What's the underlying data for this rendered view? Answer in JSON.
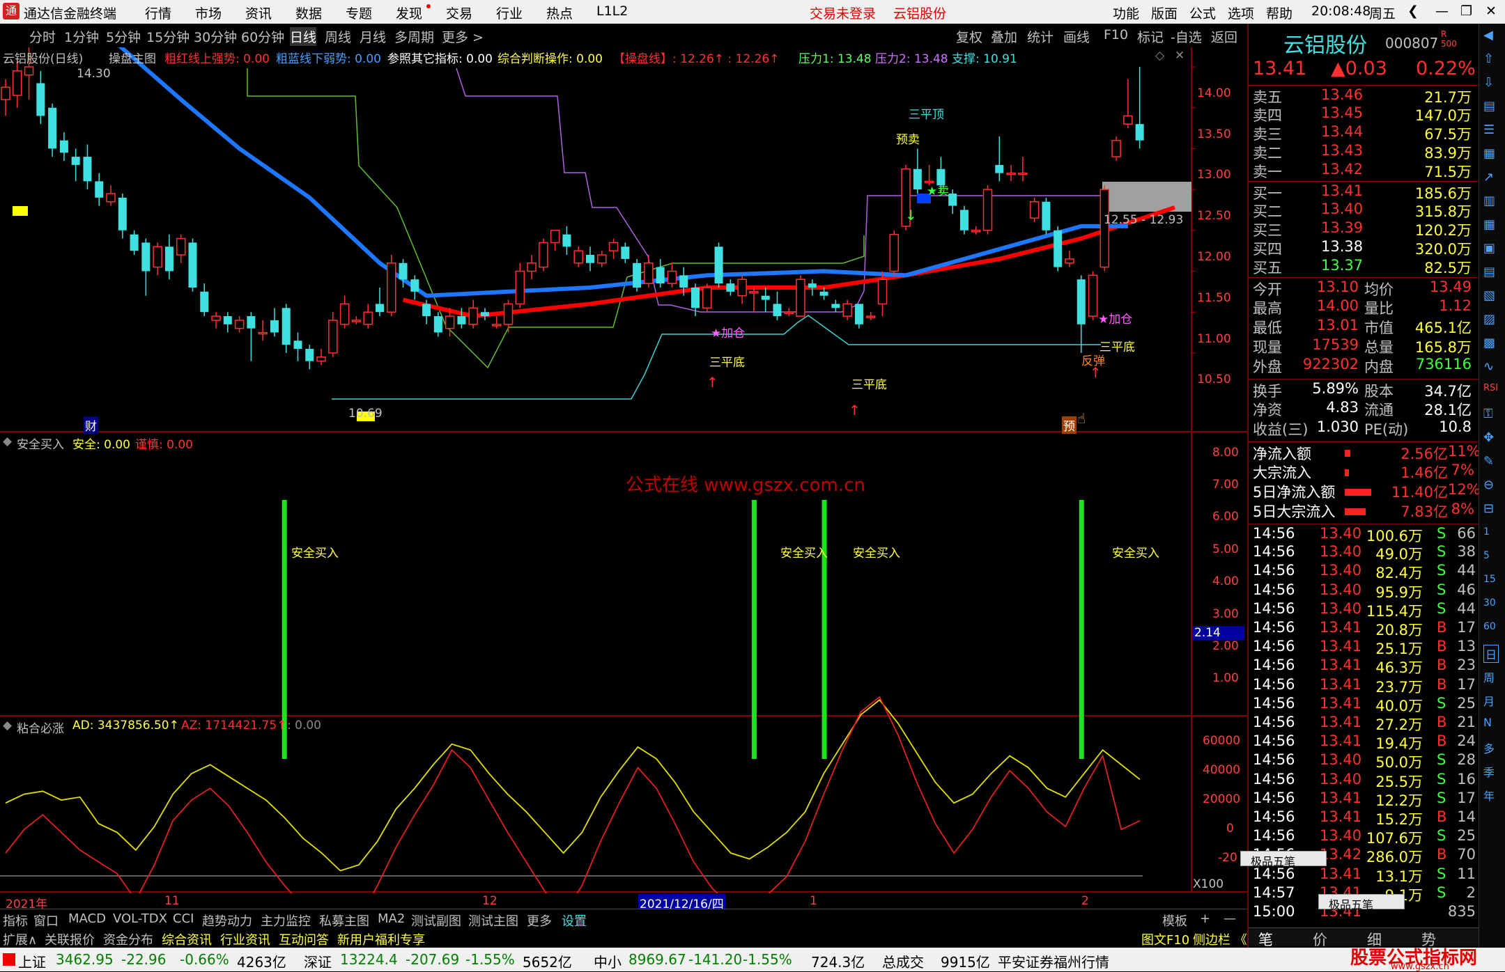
{
  "menubar": {
    "app_title": "通达信金融终端",
    "items": [
      "行情",
      "市场",
      "资讯",
      "数据",
      "专题",
      "发现",
      "交易",
      "行业",
      "热点",
      "L1L2"
    ],
    "login": "交易未登录",
    "stock": "云铝股份",
    "right_items": [
      "功能",
      "版面",
      "公式",
      "选项",
      "帮助"
    ],
    "time": "20:08:48",
    "weekday": "周五"
  },
  "periodbar": {
    "items": [
      "分时",
      "1分钟",
      "5分钟",
      "15分钟",
      "30分钟",
      "60分钟",
      "日线",
      "周线",
      "月线",
      "多周期",
      "更多 >"
    ],
    "right_items": [
      "复权",
      "叠加",
      "统计",
      "画线",
      "F10",
      "标记",
      "-自选",
      "返回"
    ]
  },
  "main_header": {
    "name": "云铝股份(日线)",
    "indicator": "操盘主图",
    "red_line": "粗红线上强势: 0.00",
    "blue_line": "粗蓝线下弱势: 0.00",
    "ref": "参照其它指标: 0.00",
    "judge": "综合判断操作: 0.00",
    "caopan": "【操盘线】: 12.26↑ : 12.26↑",
    "p1": "压力1: 13.48",
    "p2": "压力2: 13.48",
    "support": "支撑: 10.91"
  },
  "price_axis": [
    "14.00",
    "13.50",
    "13.00",
    "12.50",
    "12.00",
    "11.50",
    "11.00",
    "10.50"
  ],
  "chart_labels": {
    "high": "14.30",
    "low": "10.69",
    "range_box": "12.55 - 12.93",
    "sanpingding": "三平顶",
    "yumai": "预卖",
    "sell": "★卖",
    "jiacang1": "★加仓",
    "jiacang2": "★加仓",
    "sanpingdi1": "三平底",
    "sanpingdi2": "三平底",
    "sanpingdi3": "三平底",
    "fantan": "反弹",
    "cai": "财",
    "yu": "预"
  },
  "sub1": {
    "name": "安全买入",
    "safe": "安全: 0.00",
    "careful": "谨慎: 0.00",
    "label": "安全买入",
    "watermark": "公式在线 www.gszx.com.cn",
    "axis": [
      "8.00",
      "7.00",
      "6.00",
      "5.00",
      "4.00",
      "3.00",
      "2.00",
      "1.00"
    ],
    "cursor_value": "2.14"
  },
  "sub2": {
    "name": "粘合必涨",
    "ad": "AD: 3437856.50↑",
    "az": "AZ: 1714421.75↑",
    "extra": ": 0.00",
    "axis": [
      "60000",
      "40000",
      "20000",
      "0",
      "-20"
    ],
    "scale": "X100"
  },
  "time_axis": {
    "labels": [
      "2021年",
      "11",
      "12",
      "2021/12/16/四",
      "1",
      "2"
    ]
  },
  "bottom_tabs": [
    "指标",
    "窗口",
    "MACD",
    "VOL-TDX",
    "CCI",
    "趋势动力",
    "主力监控",
    "私募主图",
    "MA2",
    "测试副图",
    "测试主图",
    "更多",
    "设置"
  ],
  "bottom_right": [
    "模板",
    "+",
    "—"
  ],
  "bottom_tabs2": [
    "扩展∧",
    "关联报价",
    "资金分布",
    "综合资讯",
    "行业资讯",
    "互动问答",
    "新用户福利专享"
  ],
  "bottom_tabs2_right": [
    "图文F10",
    "侧边栏 《"
  ],
  "right_panel": {
    "title": "云铝股份",
    "code": "000807",
    "price": "13.41",
    "change": "▲0.03",
    "pct": "0.22%",
    "asks": [
      {
        "l": "卖五",
        "p": "13.46",
        "v": "21.7万"
      },
      {
        "l": "卖四",
        "p": "13.45",
        "v": "147.0万"
      },
      {
        "l": "卖三",
        "p": "13.44",
        "v": "67.5万"
      },
      {
        "l": "卖二",
        "p": "13.43",
        "v": "83.9万"
      },
      {
        "l": "卖一",
        "p": "13.42",
        "v": "71.5万"
      }
    ],
    "bids": [
      {
        "l": "买一",
        "p": "13.41",
        "v": "185.6万"
      },
      {
        "l": "买二",
        "p": "13.40",
        "v": "315.8万"
      },
      {
        "l": "买三",
        "p": "13.39",
        "v": "120.2万"
      },
      {
        "l": "买四",
        "p": "13.38",
        "v": "320.0万"
      },
      {
        "l": "买五",
        "p": "13.37",
        "v": "82.5万"
      }
    ],
    "stats": [
      [
        "今开",
        "13.10",
        "均价",
        "13.49"
      ],
      [
        "最高",
        "14.00",
        "量比",
        "1.12"
      ],
      [
        "最低",
        "13.01",
        "市值",
        "465.1亿"
      ],
      [
        "现量",
        "17539",
        "总量",
        "165.8万"
      ],
      [
        "外盘",
        "922302",
        "内盘",
        "736116"
      ]
    ],
    "stats2": [
      [
        "换手",
        "5.89%",
        "股本",
        "34.7亿"
      ],
      [
        "净资",
        "4.83",
        "流通",
        "28.1亿"
      ],
      [
        "收益(三)",
        "1.030",
        "PE(动)",
        "10.8"
      ]
    ],
    "flows": [
      [
        "净流入额",
        "2.56亿",
        "11%"
      ],
      [
        "大宗流入",
        "1.46亿",
        "7%"
      ],
      [
        "5日净流入额",
        "11.40亿",
        "12%"
      ],
      [
        "5日大宗流入",
        "7.83亿",
        "8%"
      ]
    ],
    "ticks": [
      [
        "14:56",
        "13.40",
        "100.6万",
        "S",
        "66"
      ],
      [
        "14:56",
        "13.40",
        "49.0万",
        "S",
        "38"
      ],
      [
        "14:56",
        "13.40",
        "82.4万",
        "S",
        "44"
      ],
      [
        "14:56",
        "13.40",
        "95.9万",
        "S",
        "46"
      ],
      [
        "14:56",
        "13.40",
        "115.4万",
        "S",
        "44"
      ],
      [
        "14:56",
        "13.41",
        "20.8万",
        "B",
        "17"
      ],
      [
        "14:56",
        "13.41",
        "25.1万",
        "B",
        "13"
      ],
      [
        "14:56",
        "13.41",
        "46.3万",
        "B",
        "23"
      ],
      [
        "14:56",
        "13.41",
        "23.7万",
        "B",
        "17"
      ],
      [
        "14:56",
        "13.41",
        "40.0万",
        "S",
        "25"
      ],
      [
        "14:56",
        "13.41",
        "27.2万",
        "B",
        "21"
      ],
      [
        "14:56",
        "13.41",
        "19.4万",
        "B",
        "24"
      ],
      [
        "14:56",
        "13.40",
        "50.0万",
        "S",
        "28"
      ],
      [
        "14:56",
        "13.40",
        "25.5万",
        "S",
        "16"
      ],
      [
        "14:56",
        "13.41",
        "12.2万",
        "S",
        "17"
      ],
      [
        "14:56",
        "13.41",
        "15.2万",
        "B",
        "14"
      ],
      [
        "14:56",
        "13.40",
        "107.6万",
        "S",
        "25"
      ],
      [
        "14:56",
        "13.42",
        "286.0万",
        "B",
        "70"
      ],
      [
        "14:56",
        "13.41",
        "13.1万",
        "S",
        "11"
      ],
      [
        "14:57",
        "13.41",
        "9.1万",
        "S",
        "2"
      ],
      [
        "15:00",
        "13.41",
        "",
        "",
        "835"
      ]
    ],
    "popup1": "极品五笔",
    "popup2": "极品五笔",
    "tabs": [
      "笔",
      "价",
      "细",
      "势"
    ]
  },
  "status": {
    "sh": "上证",
    "sh_v": "3462.95",
    "sh_c": "-22.96",
    "sh_p": "-0.66%",
    "sh_a": "4263亿",
    "sz": "深证",
    "sz_v": "13224.4",
    "sz_c": "-207.69",
    "sz_p": "-1.55%",
    "sz_a": "5652亿",
    "zx": "中小",
    "zx_v": "8969.67",
    "zx_c": "-141.20",
    "zx_p": "-1.55%",
    "zx_a": "724.3亿",
    "tot": "总成交",
    "tot_v": "9915亿",
    "broker": "平安证券福州行情",
    "brand": "股票公式指标网",
    "site": "www.gszx.cn"
  },
  "chart_data": {
    "type": "candlestick",
    "title": "云铝股份(日线)",
    "ylim": [
      10.3,
      14.4
    ],
    "candles": [
      [
        13.6,
        13.75,
        13.4,
        13.85
      ],
      [
        13.65,
        13.95,
        13.5,
        14.1
      ],
      [
        13.9,
        14.0,
        13.6,
        14.3
      ],
      [
        13.8,
        13.4,
        13.3,
        13.95
      ],
      [
        13.5,
        13.0,
        12.9,
        13.55
      ],
      [
        13.1,
        12.95,
        12.85,
        13.2
      ],
      [
        12.9,
        12.8,
        12.6,
        13.0
      ],
      [
        12.9,
        12.6,
        12.5,
        13.05
      ],
      [
        12.6,
        12.4,
        12.3,
        12.7
      ],
      [
        12.35,
        12.45,
        12.3,
        12.55
      ],
      [
        12.4,
        12.0,
        11.9,
        12.45
      ],
      [
        11.95,
        11.75,
        11.7,
        12.0
      ],
      [
        11.85,
        11.5,
        11.2,
        11.9
      ],
      [
        11.55,
        11.8,
        11.45,
        11.85
      ],
      [
        11.8,
        11.5,
        11.4,
        11.95
      ],
      [
        11.7,
        11.9,
        11.6,
        11.95
      ],
      [
        11.85,
        11.3,
        11.25,
        11.9
      ],
      [
        11.25,
        11.0,
        10.95,
        11.35
      ],
      [
        10.9,
        10.95,
        10.8,
        11.0
      ],
      [
        10.95,
        10.85,
        10.75,
        11.0
      ],
      [
        10.8,
        10.9,
        10.75,
        10.95
      ],
      [
        10.95,
        10.8,
        10.4,
        11.0
      ],
      [
        10.75,
        10.75,
        10.65,
        10.9
      ],
      [
        10.9,
        10.75,
        10.7,
        11.05
      ],
      [
        11.05,
        10.6,
        10.5,
        11.1
      ],
      [
        10.65,
        10.55,
        10.4,
        10.75
      ],
      [
        10.55,
        10.4,
        10.3,
        10.6
      ],
      [
        10.4,
        10.45,
        10.35,
        10.55
      ],
      [
        10.5,
        10.9,
        10.45,
        11.0
      ],
      [
        10.85,
        11.1,
        10.8,
        11.2
      ],
      [
        10.9,
        10.9,
        10.85,
        10.95
      ],
      [
        10.85,
        11.0,
        10.8,
        11.1
      ],
      [
        11.1,
        11.0,
        10.95,
        11.3
      ],
      [
        11.0,
        11.6,
        10.95,
        11.7
      ],
      [
        11.6,
        11.4,
        11.3,
        11.65
      ],
      [
        11.4,
        11.25,
        11.15,
        11.45
      ],
      [
        11.1,
        10.95,
        10.85,
        11.15
      ],
      [
        10.95,
        10.75,
        10.7,
        11.0
      ],
      [
        10.8,
        10.95,
        10.7,
        11.05
      ],
      [
        10.95,
        10.85,
        10.8,
        11.05
      ],
      [
        10.85,
        11.05,
        10.8,
        11.15
      ],
      [
        11.0,
        10.95,
        10.9,
        11.05
      ],
      [
        10.85,
        10.85,
        10.8,
        10.95
      ],
      [
        10.85,
        11.1,
        10.75,
        11.15
      ],
      [
        11.1,
        11.5,
        11.05,
        11.6
      ],
      [
        11.5,
        11.6,
        11.4,
        11.7
      ],
      [
        11.55,
        11.85,
        11.5,
        11.9
      ],
      [
        11.85,
        12.0,
        11.75,
        12.0
      ],
      [
        11.95,
        11.8,
        11.7,
        12.05
      ],
      [
        11.6,
        11.75,
        11.55,
        11.8
      ],
      [
        11.7,
        11.6,
        11.5,
        11.8
      ],
      [
        11.6,
        11.7,
        11.55,
        11.75
      ],
      [
        11.75,
        11.85,
        11.65,
        11.9
      ],
      [
        11.8,
        11.65,
        11.6,
        11.85
      ],
      [
        11.6,
        11.3,
        11.25,
        11.65
      ],
      [
        11.35,
        11.6,
        11.3,
        11.7
      ],
      [
        11.55,
        11.35,
        11.3,
        11.65
      ],
      [
        11.35,
        11.5,
        11.3,
        11.6
      ],
      [
        11.45,
        11.3,
        11.2,
        11.55
      ],
      [
        11.3,
        11.05,
        10.95,
        11.35
      ],
      [
        11.05,
        11.3,
        11.0,
        11.35
      ],
      [
        11.8,
        11.35,
        11.3,
        11.85
      ],
      [
        11.35,
        11.25,
        11.2,
        11.4
      ],
      [
        11.2,
        11.4,
        11.1,
        11.45
      ],
      [
        11.25,
        11.25,
        11.0,
        11.3
      ],
      [
        11.2,
        11.15,
        11.0,
        11.3
      ],
      [
        11.1,
        10.95,
        10.9,
        11.25
      ],
      [
        11.0,
        11.0,
        10.95,
        11.05
      ],
      [
        10.95,
        11.4,
        10.95,
        11.45
      ],
      [
        11.35,
        11.3,
        11.2,
        11.4
      ],
      [
        11.25,
        11.2,
        11.15,
        11.3
      ],
      [
        11.1,
        11.05,
        11.0,
        11.15
      ],
      [
        10.95,
        11.1,
        10.9,
        11.15
      ],
      [
        11.1,
        10.85,
        10.8,
        11.1
      ],
      [
        10.95,
        10.95,
        10.9,
        11.0
      ],
      [
        11.1,
        11.4,
        10.95,
        11.5
      ],
      [
        11.5,
        11.95,
        11.45,
        12.0
      ],
      [
        12.05,
        12.75,
        12.0,
        12.8
      ],
      [
        12.75,
        12.5,
        12.35,
        13.0
      ],
      [
        12.6,
        12.6,
        12.55,
        12.8
      ],
      [
        12.75,
        12.55,
        12.45,
        12.9
      ],
      [
        12.45,
        12.3,
        12.2,
        12.5
      ],
      [
        12.25,
        12.0,
        11.95,
        12.3
      ],
      [
        12.0,
        12.0,
        11.95,
        12.05
      ],
      [
        12.0,
        12.5,
        11.95,
        12.55
      ],
      [
        12.8,
        12.7,
        12.6,
        13.15
      ],
      [
        12.7,
        12.7,
        12.6,
        12.8
      ],
      [
        12.7,
        12.7,
        12.6,
        12.9
      ],
      [
        12.15,
        12.35,
        12.1,
        12.4
      ],
      [
        12.35,
        12.0,
        11.95,
        12.4
      ],
      [
        12.0,
        11.55,
        11.5,
        12.05
      ],
      [
        11.6,
        11.65,
        11.55,
        11.75
      ],
      [
        11.4,
        10.85,
        10.5,
        11.45
      ],
      [
        10.95,
        11.45,
        10.9,
        11.5
      ],
      [
        11.55,
        12.5,
        11.5,
        12.55
      ],
      [
        12.9,
        13.1,
        12.85,
        13.15
      ],
      [
        13.3,
        13.4,
        13.25,
        13.85
      ],
      [
        13.3,
        13.1,
        13.0,
        14.0
      ]
    ],
    "series": [
      {
        "name": "粗红线",
        "color": "#ff0000",
        "values": [
          [
            34,
            11.15
          ],
          [
            40,
            10.95
          ],
          [
            50,
            11.1
          ],
          [
            60,
            11.3
          ],
          [
            70,
            11.3
          ],
          [
            77,
            11.45
          ],
          [
            85,
            11.65
          ],
          [
            92,
            11.9
          ],
          [
            100,
            12.28
          ]
        ]
      },
      {
        "name": "粗蓝线",
        "color": "#1e78ff",
        "values": [
          [
            9,
            14.35
          ],
          [
            15,
            13.6
          ],
          [
            20,
            13.0
          ],
          [
            26,
            12.4
          ],
          [
            32,
            11.6
          ],
          [
            36,
            11.2
          ],
          [
            50,
            11.3
          ],
          [
            60,
            11.45
          ],
          [
            70,
            11.5
          ],
          [
            77,
            11.45
          ],
          [
            92,
            12.05
          ],
          [
            96,
            12.05
          ]
        ]
      }
    ],
    "sub1_bars_x": [
      24,
      64,
      70,
      92
    ],
    "sub2_ad": [
      2.5,
      2.8,
      2.9,
      2.6,
      2.7,
      1.8,
      1.5,
      0.9,
      1.7,
      2.8,
      3.5,
      3.8,
      3.4,
      3.0,
      2.6,
      2.0,
      1.3,
      0.8,
      0.2,
      0.4,
      1.2,
      2.3,
      3.0,
      3.8,
      4.5,
      4.3,
      3.5,
      2.8,
      2.2,
      1.5,
      0.8,
      1.5,
      2.7,
      3.6,
      4.4,
      4.0,
      3.2,
      2.2,
      1.5,
      0.8,
      0.6,
      1.0,
      1.5,
      2.2,
      3.5,
      4.5,
      5.5,
      6.0,
      5.2,
      4.2,
      3.2,
      2.5,
      2.8,
      3.5,
      4.1,
      3.7,
      3.0,
      2.7,
      3.5,
      4.3,
      3.8,
      3.3
    ],
    "sub2_az": [
      0.8,
      1.6,
      2.1,
      1.5,
      0.9,
      0.5,
      0.1,
      -0.8,
      0.4,
      1.9,
      2.6,
      3.0,
      2.4,
      1.5,
      0.5,
      -0.3,
      -1.0,
      -1.7,
      -2.2,
      -1.5,
      -0.3,
      1.0,
      2.1,
      3.1,
      4.3,
      3.7,
      2.6,
      1.5,
      0.5,
      -0.5,
      -1.3,
      -0.3,
      1.2,
      2.5,
      3.7,
      3.0,
      1.8,
      0.5,
      -0.4,
      -1.0,
      -1.2,
      -0.6,
      0.0,
      1.2,
      2.8,
      4.3,
      5.6,
      6.1,
      4.8,
      3.2,
      1.8,
      0.8,
      1.6,
      2.7,
      3.6,
      3.0,
      2.2,
      1.7,
      3.0,
      4.1,
      1.6,
      1.9
    ]
  }
}
